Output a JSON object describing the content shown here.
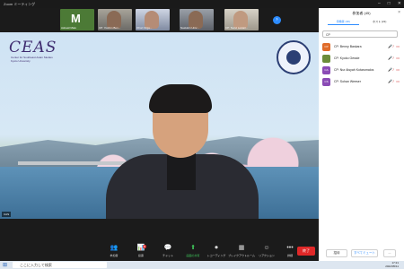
{
  "window": {
    "title": "Zoom ミーティング"
  },
  "thumbnails": [
    {
      "name": "Asbasil Malo",
      "initial": "M"
    },
    {
      "name": "CP: Yoshim Ben...",
      "initial": ""
    },
    {
      "name": "Ohori Orga...",
      "initial": ""
    },
    {
      "name": "Naslukin Univ...",
      "initial": ""
    },
    {
      "name": "CP: Nurul Lestari...",
      "initial": ""
    }
  ],
  "strip_more": "›",
  "video": {
    "logo": "CEAS",
    "logo_sub1": "Center for Southeast Asian Studies",
    "logo_sub2": "Kyoto University",
    "speaker_tag": "CAS"
  },
  "toolbar": {
    "items": [
      {
        "label": "参加者",
        "icon": "👥",
        "name": "participants"
      },
      {
        "label": "投票",
        "icon": "📊",
        "name": "polls"
      },
      {
        "label": "チャット",
        "icon": "💬",
        "name": "chat"
      },
      {
        "label": "画面の共有",
        "icon": "⬆",
        "name": "share-screen"
      },
      {
        "label": "レコーディング",
        "icon": "⏺",
        "name": "record"
      },
      {
        "label": "ブレイクアウトルーム",
        "icon": "▦",
        "name": "breakout"
      },
      {
        "label": "リアクション",
        "icon": "☺",
        "name": "reactions"
      },
      {
        "label": "詳細",
        "icon": "•••",
        "name": "more"
      }
    ],
    "chat_badge": "8",
    "leave": "終了"
  },
  "panel": {
    "title": "参加者 (45)",
    "close": "×",
    "tabs": [
      "待機者 (38)",
      "ホスト (21)"
    ],
    "search_value": "CP",
    "participants": [
      {
        "initials": "CP",
        "name": "CP: Benny Baskara",
        "color": "#e06c2a"
      },
      {
        "initials": "",
        "name": "CP: Kyoko Gessle",
        "color": "#6b8c3a"
      },
      {
        "initials": "CA",
        "name": "CP: Nur Aisyah Kotarumalos",
        "color": "#8a4bb5"
      },
      {
        "initials": "CS",
        "name": "CP: Sohan Weeser",
        "color": "#8a4bb5"
      }
    ],
    "footer": {
      "invite": "招待",
      "mute_all": "すべてミュート",
      "more": "..."
    }
  },
  "taskbar": {
    "search": "ここに入力して検索",
    "time": "17:21",
    "date": "2022/05/11"
  }
}
